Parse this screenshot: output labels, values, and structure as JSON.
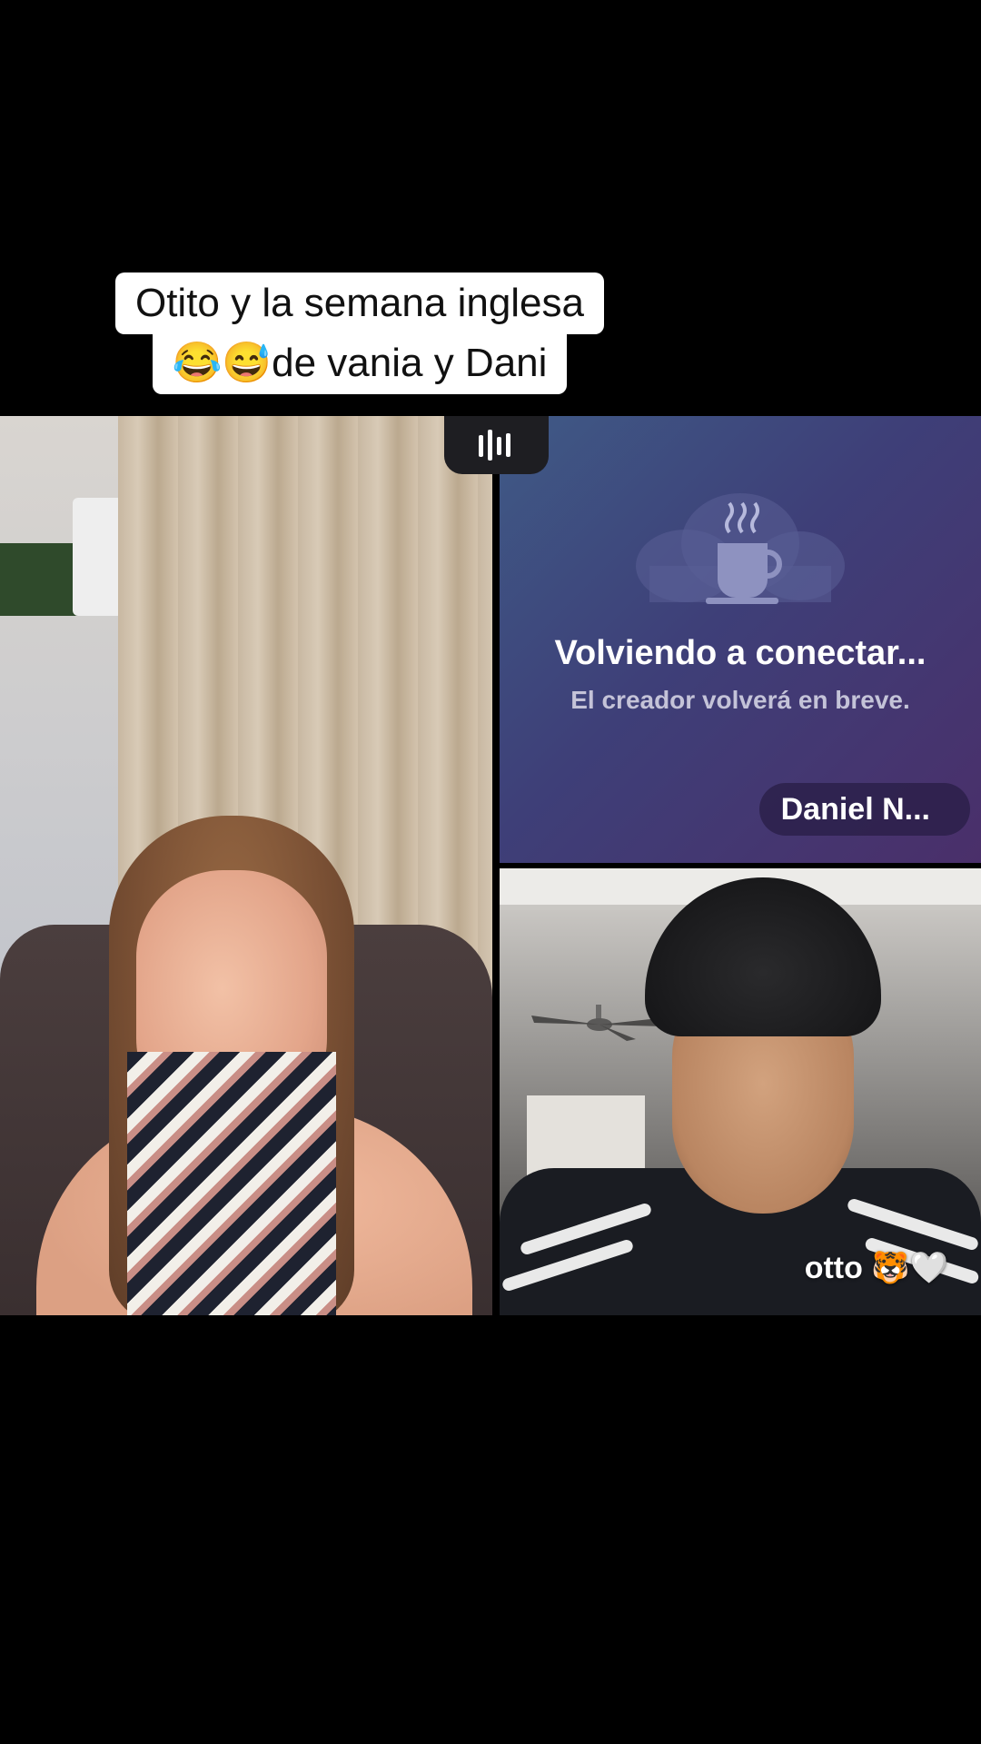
{
  "caption": {
    "line1": "Otito y la semana inglesa",
    "line2": "😂😅de vania y Dani"
  },
  "live": {
    "reconnect": {
      "title": "Volviendo a conectar...",
      "subtitle": "El creador volverá en breve.",
      "name": "Daniel N..."
    },
    "guest": {
      "name": "otto 🐯🤍"
    },
    "icons": {
      "audio": "audio-levels-icon",
      "reconnect": "coffee-cup-icon"
    }
  },
  "colors": {
    "background": "#000000",
    "caption_bg": "#ffffff",
    "reconnect_gradient_start": "#3f5a86",
    "reconnect_gradient_end": "#4a2f6a"
  }
}
